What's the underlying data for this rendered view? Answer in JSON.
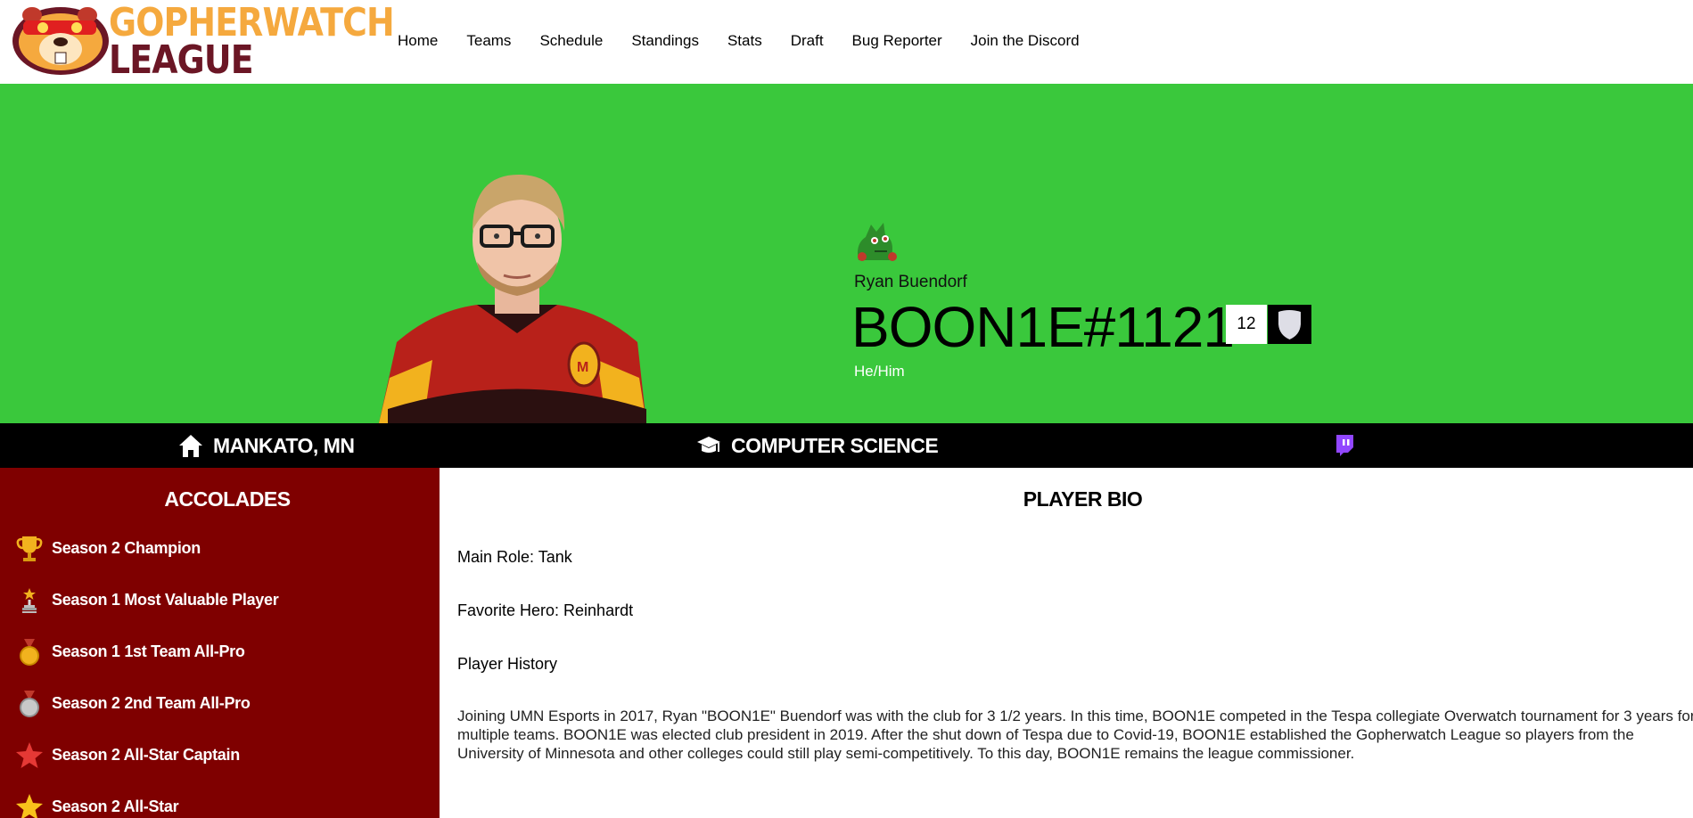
{
  "header": {
    "logo_line1": "GOPHERWATCH",
    "logo_line2": "LEAGUE",
    "nav": [
      "Home",
      "Teams",
      "Schedule",
      "Standings",
      "Stats",
      "Draft",
      "Bug Reporter",
      "Join the Discord"
    ]
  },
  "player": {
    "real_name": "Ryan Buendorf",
    "battletag": "BOON1E#1121",
    "rank_number": "12",
    "pronouns": "He/Him"
  },
  "info": {
    "hometown": "MANKATO, MN",
    "major": "COMPUTER SCIENCE",
    "social_icon": "twitch-icon"
  },
  "accolades": {
    "title": "ACCOLADES",
    "items": [
      {
        "label": "Season 2 Champion",
        "icon": "trophy-icon"
      },
      {
        "label": "Season 1 Most Valuable Player",
        "icon": "mvp-award-icon"
      },
      {
        "label": "Season 1 1st Team All-Pro",
        "icon": "gold-medal-icon"
      },
      {
        "label": "Season 2 2nd Team All-Pro",
        "icon": "silver-medal-icon"
      },
      {
        "label": "Season 2 All-Star Captain",
        "icon": "red-star-icon"
      },
      {
        "label": "Season 2 All-Star",
        "icon": "gold-star-icon"
      }
    ]
  },
  "bio": {
    "title": "PLAYER BIO",
    "main_role": "Main Role: Tank",
    "favorite_hero": "Favorite Hero: Reinhardt",
    "history_heading": "Player History",
    "history_text": "Joining UMN Esports in 2017, Ryan \"BOON1E\" Buendorf was with the club for 3 1/2 years. In this time, BOON1E competed in the Tespa collegiate Overwatch tournament for 3 years for multiple teams. BOON1E was elected club president in 2019. After the shut down of Tespa due to Covid-19, BOON1E established the Gopherwatch League so players from the University of Minnesota and other colleges could still play semi-competitively. To this day, BOON1E remains the league commissioner."
  },
  "colors": {
    "hero_bg": "#3ac83c",
    "accolades_bg": "#7f0000",
    "logo_orange": "#f5a93e",
    "logo_maroon": "#6b1625",
    "twitch_purple": "#9146ff"
  }
}
